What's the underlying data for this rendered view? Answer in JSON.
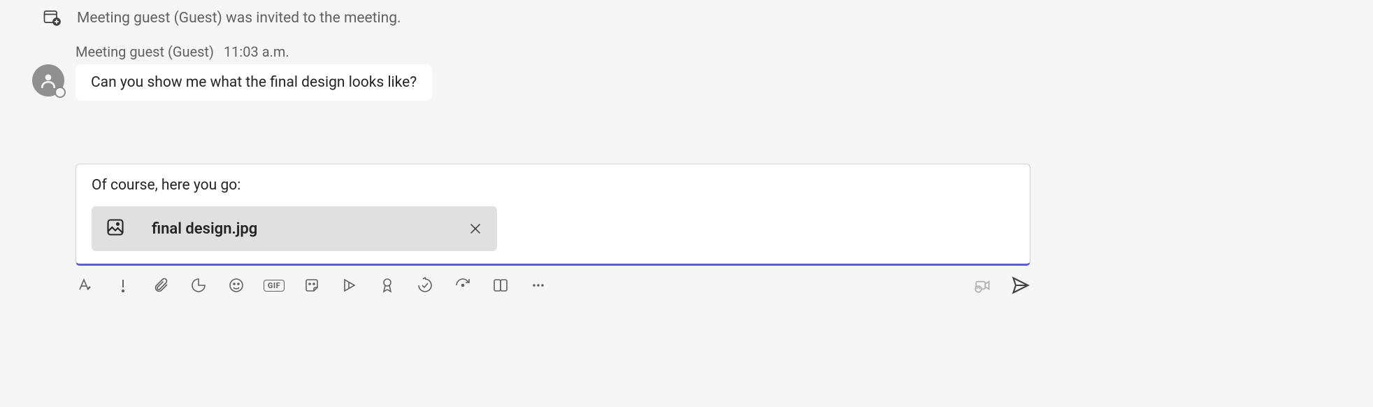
{
  "system_message": {
    "text": "Meeting guest (Guest) was invited to the meeting."
  },
  "message": {
    "sender": "Meeting guest (Guest)",
    "timestamp": "11:03 a.m.",
    "body": "Can you show me what the final design looks like?"
  },
  "compose": {
    "text": "Of course, here you go:",
    "attachment": {
      "name": "final design.jpg"
    }
  },
  "toolbar": {
    "gif_label": "GIF"
  }
}
